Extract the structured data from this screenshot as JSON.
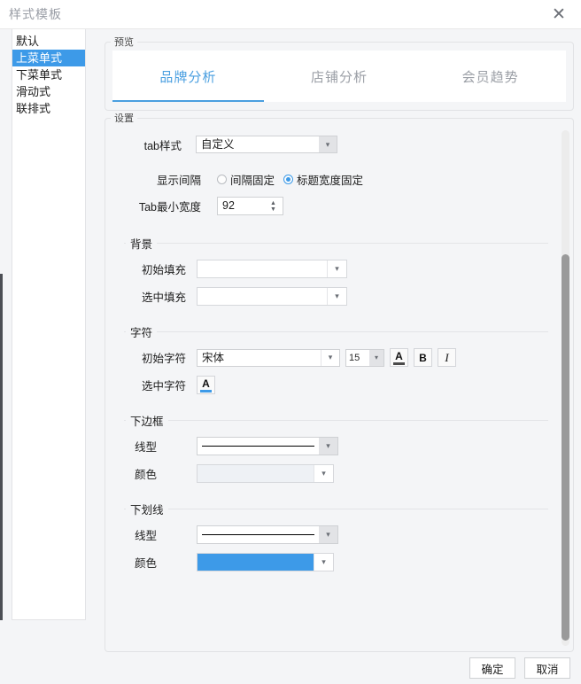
{
  "window": {
    "title": "样式模板",
    "close_icon": "close-icon"
  },
  "sidebar": {
    "items": [
      {
        "label": "默认",
        "selected": false
      },
      {
        "label": "上菜单式",
        "selected": true
      },
      {
        "label": "下菜单式",
        "selected": false
      },
      {
        "label": "滑动式",
        "selected": false
      },
      {
        "label": "联排式",
        "selected": false
      }
    ]
  },
  "preview": {
    "legend": "预览",
    "tabs": [
      {
        "label": "品牌分析",
        "active": true
      },
      {
        "label": "店铺分析",
        "active": false
      },
      {
        "label": "会员趋势",
        "active": false
      }
    ],
    "active_color": "#4a9fe0",
    "inactive_color": "#9b9fa6"
  },
  "settings": {
    "legend": "设置",
    "tab_style": {
      "label": "tab样式",
      "value": "自定义",
      "arrow_icon": "chevron-down-icon"
    },
    "display_interval": {
      "label": "显示间隔",
      "options": [
        {
          "label": "间隔固定",
          "checked": false
        },
        {
          "label": "标题宽度固定",
          "checked": true
        }
      ]
    },
    "tab_min_width": {
      "label": "Tab最小宽度",
      "value": "92",
      "up_icon": "spinner-up-icon",
      "down_icon": "spinner-down-icon"
    },
    "background": {
      "legend": "背景",
      "initial_fill": {
        "label": "初始填充",
        "color": "",
        "arrow_icon": "chevron-down-icon"
      },
      "selected_fill": {
        "label": "选中填充",
        "color": "",
        "arrow_icon": "chevron-down-icon"
      }
    },
    "character": {
      "legend": "字符",
      "initial_char": {
        "label": "初始字符",
        "font": "宋体",
        "size": "15",
        "font_color_icon": "font-color-icon",
        "font_color_bar": "#4a4a4a",
        "bold_label": "B",
        "italic_label": "I",
        "font_glyph": "A"
      },
      "selected_char": {
        "label": "选中字符",
        "font_color_icon": "font-color-icon",
        "font_color_bar": "#3d9ae8",
        "font_glyph": "A"
      }
    },
    "bottom_border": {
      "legend": "下边框",
      "line_style": {
        "label": "线型",
        "preview": "solid",
        "arrow_icon": "chevron-down-icon"
      },
      "color": {
        "label": "颜色",
        "color": "#eef1f5",
        "arrow_icon": "chevron-down-icon"
      }
    },
    "underline": {
      "legend": "下划线",
      "line_style": {
        "label": "线型",
        "preview": "solid",
        "arrow_icon": "chevron-down-icon"
      },
      "color": {
        "label": "颜色",
        "color": "#3d9ae8",
        "arrow_icon": "chevron-down-icon"
      }
    },
    "scrollbar": {
      "name": "vertical-scrollbar"
    }
  },
  "footer": {
    "ok_label": "确定",
    "cancel_label": "取消"
  }
}
